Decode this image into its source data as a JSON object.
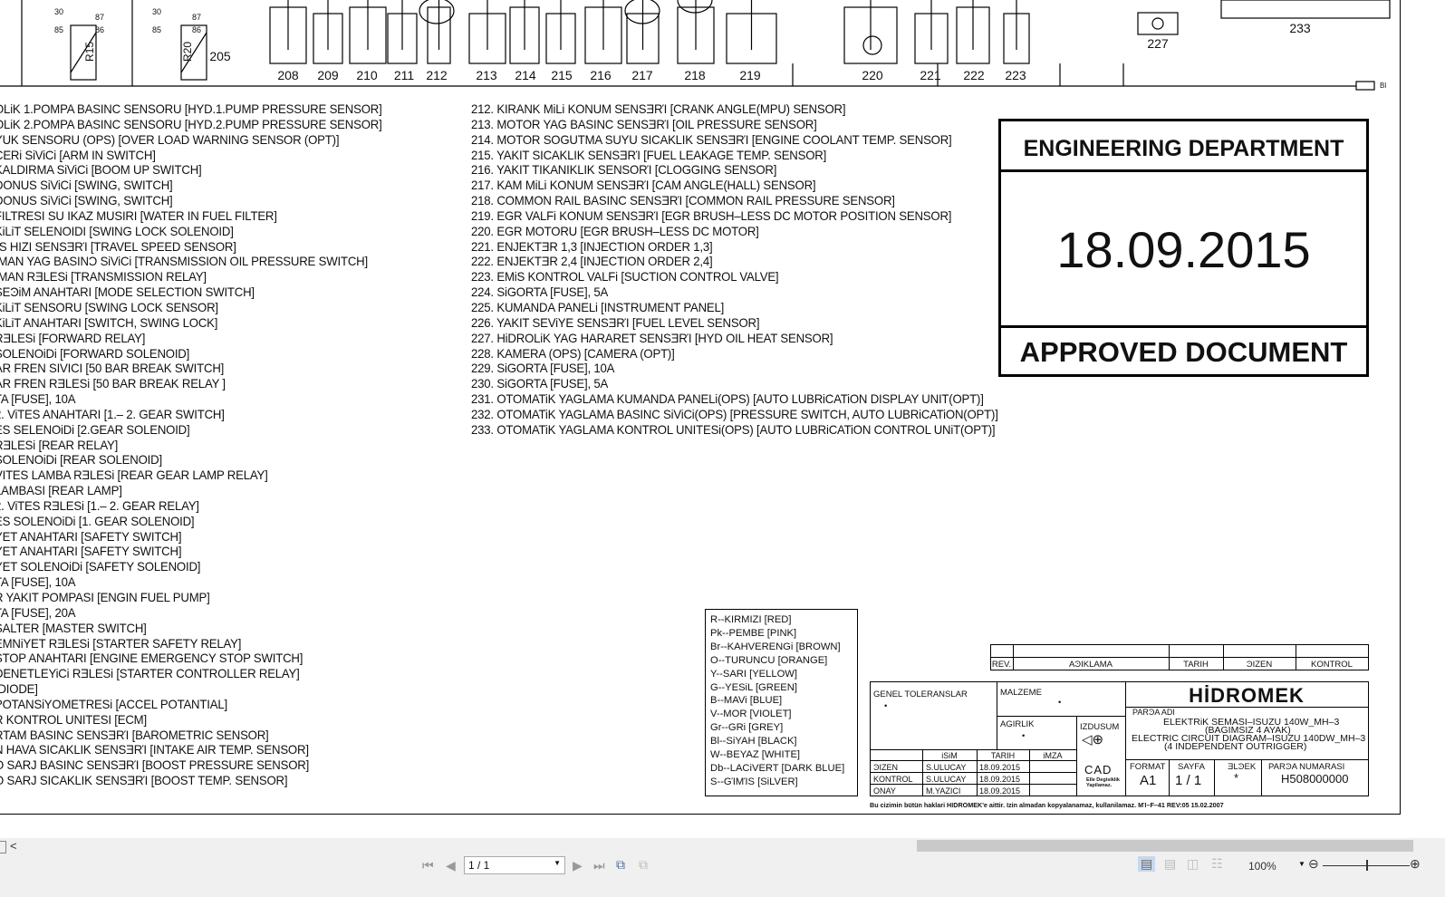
{
  "schematic": {
    "relay_labels": [
      "30",
      "87",
      "85",
      "86",
      "R15",
      "30",
      "87",
      "85",
      "86",
      "R20"
    ],
    "component_numbers": [
      "205",
      "208",
      "209",
      "210",
      "211",
      "212",
      "213",
      "214",
      "215",
      "216",
      "217",
      "218",
      "219",
      "220",
      "221",
      "222",
      "223",
      "227",
      "233"
    ],
    "bus_end_label": "Bl"
  },
  "left_list": [
    "OLiK 1.POMPA BASINC SENSORU [HYD.1.PUMP PRESSURE SENSOR]",
    "OLiK 2.POMPA BASINC SENSORU [HYD.2.PUMP PRESSURE SENSOR]",
    " YUK SENSORU (OPS) [OVER LOAD WARNING SENSOR (OPT)]",
    "CERi SiViCi [ARM IN SWITCH]",
    "KALDIRMA SiViCi [BOOM UP SWITCH]",
    " DONUS SiViCi [SWING, SWITCH]",
    " DONUS SiViCi [SWING, SWITCH]",
    " FILTRESI SU IKAZ MUSIRI [WATER IN FUEL FILTER]",
    " KiLiT SELENOIDI [SWING LOCK SOLENOID]",
    "ΊS HIZI SENSƎRΊ [TRAVEL SPEED SENSOR]",
    "IMAN YAG BASINϽ SiViCi [TRANSMISSION OIL PRESSURE SWITCH]",
    "IMAN RƎLESi [TRANSMISSION RELAY]",
    "SEϿiM ANAHTARI [MODE SELECTION SWITCH]",
    " KiLiT SENSORU [SWING LOCK SENSOR]",
    " KiLiT ANAHTARI [SWITCH, SWING LOCK]",
    "RƎLESi [FORWARD RELAY]",
    "SOLENOiDi [FORWARD SOLENOID]",
    "AR FREN SIVICI [50 BAR BREAK SWITCH]",
    "AR FREN RƎLESi [50 BAR BREAK RELAY ]",
    "TA [FUSE], 10A",
    " 2. ViTES ANAHTARI [1.– 2. GEAR SWITCH]",
    "ES SELENOiDi [2.GEAR SOLENOID]",
    "RƎLESi [REAR RELAY]",
    "SOLENOiDi [REAR SOLENOID]",
    "VITES LAMBA RƎLESi [REAR GEAR LAMP RELAY]",
    "LAMBASI [REAR LAMP]",
    " 2. ViTES RƎLESi [1.– 2. GEAR RELAY]",
    "ES SOLENOiDi [1. GEAR SOLENOID]",
    "YET ANAHTARI [SAFETY SWITCH]",
    "YET ANAHTARI [SAFETY SWITCH]",
    "YET SOLENOiDi [SAFETY SOLENOID]",
    "TA [FUSE], 10A",
    "R YAKIT POMPASI [ENGIN FUEL PUMP]",
    "TA [FUSE], 20A",
    "SALTER [MASTER SWITCH]",
    " EMNiYET RƎLESi [STARTER SAFETY RELAY]",
    "STOP ANAHTARI [ENGINE EMERGENCY STOP SWITCH]",
    " DENETLEYiCi RƎLESi [STARTER CONTROLLER RELAY]",
    " [DIODE]",
    "POTANSiYOMETRESi [ACCEL POTANTIAL]",
    "R KONTROL UNITESI [ECM]",
    "RTAM BASINC SENSƎRΊ [BAROMETRIC SENSOR]",
    "N HAVA SICAKLIK SENSƎRΊ [INTAKE AIR TEMP. SENSOR]",
    "O SARJ BASINC SENSƎRΊ [BOOST PRESSURE SENSOR]",
    "O SARJ SICAKLIK SENSƎRΊ [BOOST TEMP. SENSOR]"
  ],
  "mid_list": [
    "212. KIRANK MiLi KONUM SENSƎRΊ [CRANK ANGLE(MPU) SENSOR]",
    "213. MOTOR YAG BASINC SENSƎRΊ [OIL PRESSURE SENSOR]",
    "214. MOTOR SOGUTMA SUYU SICAKLIK SENSƎRΊ [ENGINE COOLANT TEMP. SENSOR]",
    "215. YAKIT SICAKLIK SENSƎRΊ [FUEL LEAKAGE TEMP. SENSOR]",
    "216. YAKIT TIKANIKLIK SENSORΊ [CLOGGING SENSOR]",
    "217. KAM MiLi KONUM SENSƎRΊ [CAM ANGLE(HALL) SENSOR]",
    "218. COMMON RAIL BASINC SENSƎRΊ [COMMON RAIL PRESSURE SENSOR]",
    "219. EGR VALFi KONUM SENSƎRΊ [EGR BRUSH–LESS DC MOTOR POSITION SENSOR]",
    "220. EGR MOTORU [EGR BRUSH–LESS DC MOTOR]",
    "221. ENJEKTƎR 1,3 [INJECTION ORDER 1,3]",
    "222. ENJEKTƎR 2,4 [INJECTION ORDER 2,4]",
    "223. EMiS KONTROL VALFi [SUCTION CONTROL VALVE]",
    "224. SiGORTA [FUSE], 5A",
    "225. KUMANDA PANELi [INSTRUMENT PANEL]",
    "226. YAKIT SEViYE SENSƎRΊ [FUEL LEVEL SENSOR]",
    "227. HiDROLiK YAG HARARET SENSƎRΊ [HYD OIL HEAT SENSOR]",
    "228. KAMERA (OPS) [CAMERA (OPT)]",
    "229. SiGORTA [FUSE], 10A",
    "230. SiGORTA [FUSE], 5A",
    "231. OTOMATiK YAGLAMA KUMANDA PANELi(OPS) [AUTO LUBRiCATiON DISPLAY UNIT(OPT)]",
    "232. OTOMATiK YAGLAMA BASINC SiViCi(OPS) [PRESSURE SWITCH, AUTO LUBRiCATiON(OPT)]",
    "233. OTOMATiK YAGLAMA KONTROL UNITESi(OPS) [AUTO LUBRiCATiON CONTROL UNiT(OPT)]"
  ],
  "stamp": {
    "header": "ENGINEERING  DEPARTMENT",
    "date": "18.09.2015",
    "footer": "APPROVED DOCUMENT"
  },
  "color_legend": [
    "R--KIRMIZI [RED]",
    "Pk--PEMBE [PINK]",
    "Br--KAHVERENGi [BROWN]",
    "O--TURUNCU [ORANGE]",
    "Y--SARI [YELLOW]",
    "G--YESiL [GREEN]",
    "B--MAVi [BLUE]",
    "V--MOR [VIOLET]",
    "Gr--GRi [GREY]",
    "Bl--SiYAH [BLACK]",
    "W--BEYAZ [WHITE]",
    "Db--LACiVERT [DARK BLUE]",
    "S--GΊMΊS [SiLVER]"
  ],
  "revision_table": {
    "headers": [
      "REV.",
      "AϿIKLAMA",
      "TARIH",
      "ϿIZEN",
      "KONTROL"
    ]
  },
  "title_block": {
    "tolerances_label": "GENEL TOLERANSLAR",
    "tolerances_value": "•",
    "material_label": "MALZEME",
    "material_value": "•",
    "weight_label": "AGIRLIK",
    "weight_value": "•",
    "projection_label": "IZDUSUM",
    "brand": "HİDROMEK",
    "part_name_label": "PARϿA ADI",
    "part_name_lines": [
      "ELEKTRiK SEMASI–ISUZU 140W_MH–3",
      "(BAGIMSIZ 4 AYAK)",
      "ELECTRIC CIRCUIT DIAGRAM–ISUZU 140DW_MH–3",
      "(4 INDEPENDENT OUTRIGGER)"
    ],
    "sign_headers": [
      "",
      "iSiM",
      "TARIH",
      "iMZA"
    ],
    "sign_rows": [
      [
        "ϿIZEN",
        "S.ULUCAY",
        "18.09.2015",
        ""
      ],
      [
        "KONTROL",
        "S.ULUCAY",
        "18.09.2015",
        ""
      ],
      [
        "ONAY",
        "M.YAZICI",
        "18.09.2015",
        ""
      ]
    ],
    "cad_label": "CAD",
    "cad_note": "Elle Degisiklik Yapilamaz.",
    "format_label": "FORMAT",
    "format_value": "A1",
    "page_label": "SAYFA",
    "page_value": "1 / 1",
    "scale_label": "ƎLϿEK",
    "scale_value": "*",
    "part_number_label": "PARϿA NUMARASI",
    "part_number_value": "H508000000",
    "copyright": "Bu cizimin bütün haklari HIDROMEK'e aittir. Izin almadan kopyalanamaz, kullanilamaz.  MΊ–F–41  REV:05  15.02.2007"
  },
  "viewer": {
    "page_input": "1 / 1",
    "zoom": "100%",
    "scroll_left": "<"
  }
}
